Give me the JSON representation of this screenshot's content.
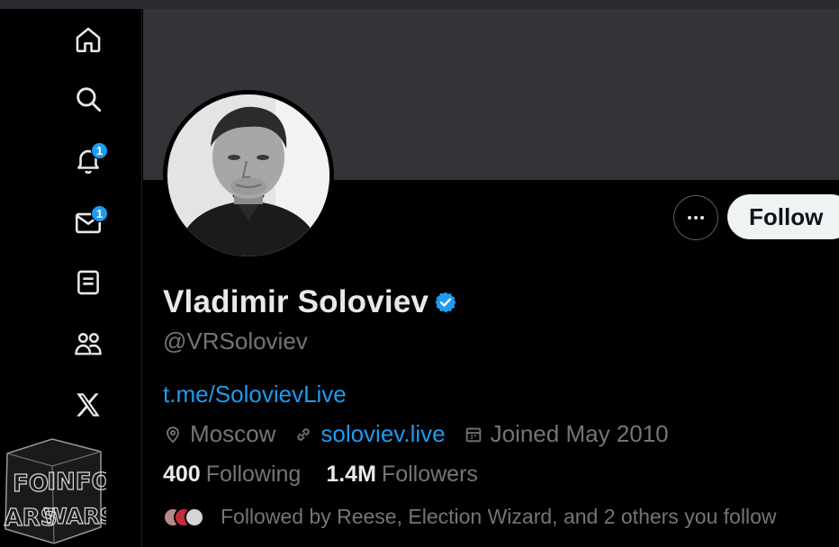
{
  "nav": {
    "items": [
      {
        "name": "home",
        "icon": "home-icon"
      },
      {
        "name": "explore",
        "icon": "search-icon"
      },
      {
        "name": "notifications",
        "icon": "bell-icon",
        "badge": "1"
      },
      {
        "name": "messages",
        "icon": "envelope-icon",
        "badge": "1"
      },
      {
        "name": "lists",
        "icon": "list-icon"
      },
      {
        "name": "communities",
        "icon": "people-icon"
      },
      {
        "name": "premium",
        "icon": "x-logo-icon"
      }
    ]
  },
  "watermark": {
    "text_top": "INFO",
    "text_bottom": "WARS"
  },
  "profile": {
    "display_name": "Vladimir Soloviev",
    "verified": true,
    "handle": "@VRSoloviev",
    "bio_link": "t.me/SolovievLive",
    "location": "Moscow",
    "website": "soloviev.live",
    "joined": "Joined May 2010",
    "following_count": "400",
    "following_label": "Following",
    "followers_count": "1.4M",
    "followers_label": "Followers",
    "followed_by": "Followed by Reese, Election Wizard, and 2 others you follow"
  },
  "actions": {
    "follow_label": "Follow",
    "more_icon": "ellipsis-icon"
  },
  "colors": {
    "accent": "#1d9bf0",
    "banner": "#333438",
    "muted_text": "#71767b",
    "follow_button_bg": "#eff3f4"
  }
}
